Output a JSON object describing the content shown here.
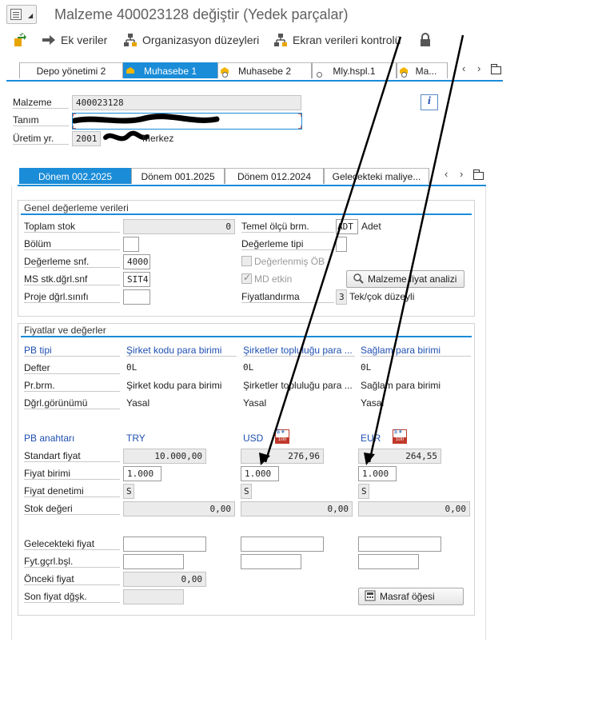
{
  "window": {
    "title": "Malzeme 400023128 değiştir (Yedek parçalar)"
  },
  "toolbar": {
    "ek_veriler": "Ek veriler",
    "organizasyon": "Organizasyon düzeyleri",
    "ekran_kontrol": "Ekran verileri kontrolü"
  },
  "view_tabs": [
    {
      "label": "Depo yönetimi 2"
    },
    {
      "label": "Muhasebe 1"
    },
    {
      "label": "Muhasebe 2"
    },
    {
      "label": "Mly.hspl.1"
    },
    {
      "label": "Ma..."
    }
  ],
  "header": {
    "malzeme_label": "Malzeme",
    "malzeme_value": "400023128",
    "tanim_label": "Tanım",
    "uretim_label": "Üretim yr.",
    "uretim_code": "2001",
    "uretim_text": "Merkez"
  },
  "period_tabs": [
    {
      "label": "Dönem 002.2025"
    },
    {
      "label": "Dönem 001.2025"
    },
    {
      "label": "Dönem 012.2024"
    },
    {
      "label": "Gelecekteki maliye..."
    }
  ],
  "genel": {
    "title": "Genel değerleme verileri",
    "toplam_stok_label": "Toplam stok",
    "toplam_stok_value": "0",
    "bolum_label": "Bölüm",
    "degerleme_snf_label": "Değerleme snf.",
    "degerleme_snf_value": "4000",
    "ms_stk_label": "MS stk.dğrl.snf",
    "ms_stk_value": "SIT4",
    "proje_label": "Proje dğrl.sınıfı",
    "temel_olcu_label": "Temel ölçü brm.",
    "temel_olcu_code": "ADT",
    "temel_olcu_text": "Adet",
    "degerleme_tipi_label": "Değerleme tipi",
    "degerlenmis_ob_label": "Değerlenmiş ÖB",
    "md_etkin_label": "MD etkin",
    "md_etkin_checked": true,
    "malzeme_fiyat_button": "Malzeme fiyat analizi",
    "fiyatlandirma_label": "Fiyatlandırma",
    "fiyatlandirma_code": "3",
    "fiyatlandirma_text": "Tek/çok düzeyli"
  },
  "fiyatlar": {
    "title": "Fiyatlar ve değerler",
    "pb_tipi_label": "PB tipi",
    "defter_label": "Defter",
    "pr_brm_label": "Pr.brm.",
    "dgrl_gor_label": "Dğrl.görünümü",
    "pb_anahtari_label": "PB anahtarı",
    "standart_fiyat_label": "Standart fiyat",
    "fiyat_birimi_label": "Fiyat birimi",
    "fiyat_denetimi_label": "Fiyat denetimi",
    "stok_degeri_label": "Stok değeri",
    "gelecekteki_fiyat_label": "Gelecekteki fiyat",
    "fyt_gcrl_label": "Fyt.gçrl.bşl.",
    "onceki_fiyat_label": "Önceki fiyat",
    "onceki_fiyat_value": "0,00",
    "son_fiyat_label": "Son fiyat dğşk.",
    "masraf_button": "Masraf öğesi",
    "columns": [
      {
        "pb_tipi": "Şirket kodu para birimi",
        "defter": "0L",
        "pr_brm": "Şirket kodu para birimi",
        "dgrl_gor": "Yasal",
        "currency": "TRY",
        "standart_fiyat": "10.000,00",
        "fiyat_birimi": "1.000",
        "fiyat_denetimi": "S",
        "stok_degeri": "0,00"
      },
      {
        "pb_tipi": "Şirketler topluluğu para ...",
        "defter": "0L",
        "pr_brm": "Şirketler topluluğu para ...",
        "dgrl_gor": "Yasal",
        "currency": "USD",
        "standart_fiyat": "276,96",
        "fiyat_birimi": "1.000",
        "fiyat_denetimi": "S",
        "stok_degeri": "0,00"
      },
      {
        "pb_tipi": "Sağlam para birimi",
        "defter": "0L",
        "pr_brm": "Sağlam para birimi",
        "dgrl_gor": "Yasal",
        "currency": "EUR",
        "standart_fiyat": "264,55",
        "fiyat_birimi": "1.000",
        "fiyat_denetimi": "S",
        "stok_degeri": "0,00"
      }
    ]
  },
  "colors": {
    "accent": "#1a8cd8",
    "link_blue": "#1f4fb0",
    "annotation": "#000000"
  }
}
